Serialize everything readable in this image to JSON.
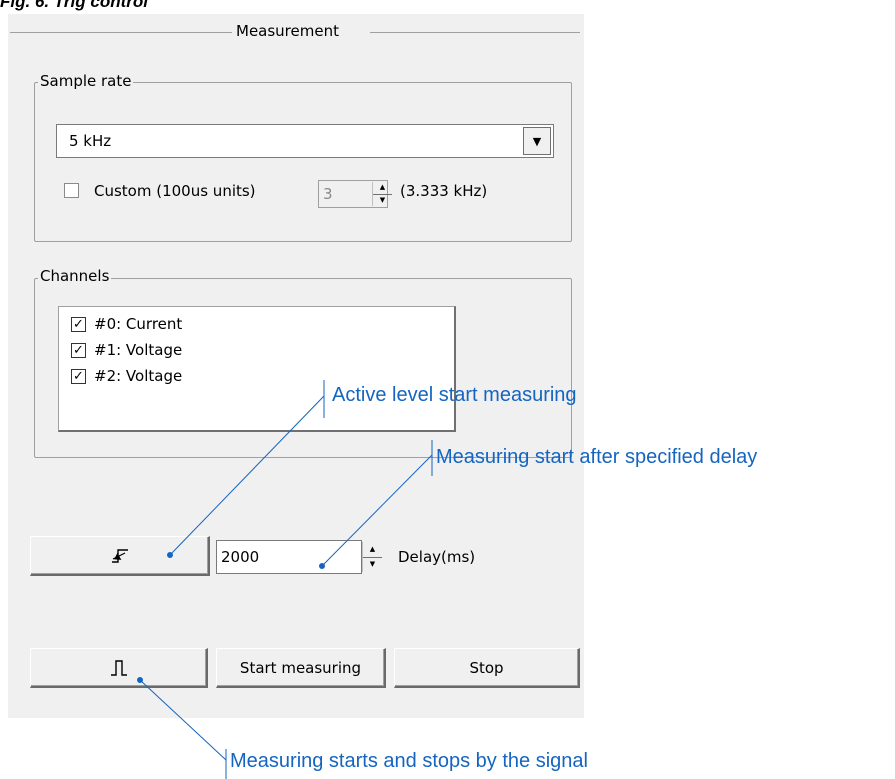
{
  "figure_caption": "Fig. 6. Trig control",
  "panel": {
    "title": "Measurement",
    "sample_rate": {
      "label": "Sample rate",
      "selected": "5 kHz",
      "custom_label": "Custom (100us units)",
      "custom_checked": false,
      "custom_value": "3",
      "custom_readout": "(3.333 kHz)"
    },
    "channels": {
      "label": "Channels",
      "items": [
        {
          "label": "#0: Current",
          "checked": true
        },
        {
          "label": "#1: Voltage",
          "checked": true
        },
        {
          "label": "#2: Voltage",
          "checked": true
        }
      ]
    },
    "delay": {
      "value": "2000",
      "label": "Delay(ms)"
    },
    "buttons": {
      "start_measuring": "Start measuring",
      "stop": "Stop"
    }
  },
  "annotations": {
    "active_level": "Active level start measuring",
    "delay": "Measuring start after specified delay",
    "signal": "Measuring starts and stops by the signal"
  },
  "colors": {
    "annotation": "#1565c0",
    "panel_bg": "#f0f0f0"
  },
  "icons": {
    "edge_trigger_button": "rising-edge-trigger-icon",
    "pulse_trigger_button": "pulse-trigger-icon"
  }
}
